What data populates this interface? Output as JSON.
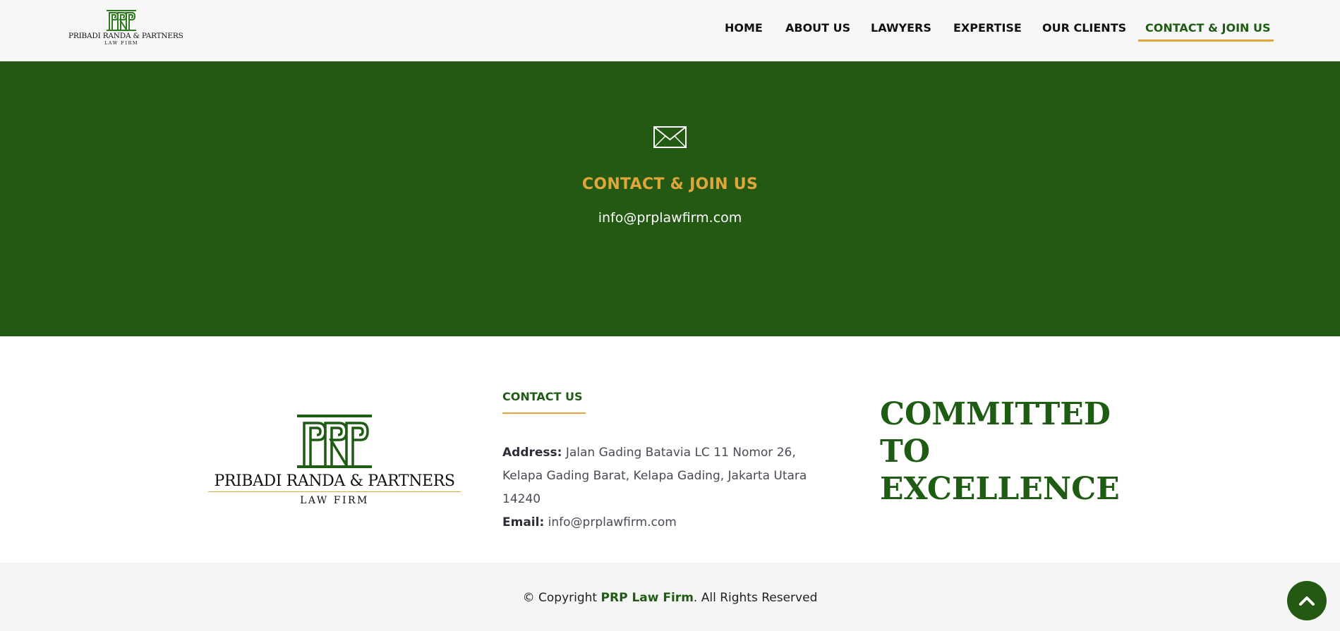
{
  "header": {
    "logo": {
      "monogram": "PRP",
      "firm_name": "PRIBADI RANDA & PARTNERS",
      "firm_sub": "LAW FIRM"
    },
    "nav": [
      {
        "label": "HOME"
      },
      {
        "label": "ABOUT US"
      },
      {
        "label": "LAWYERS"
      },
      {
        "label": "EXPERTISE"
      },
      {
        "label": "OUR CLIENTS"
      },
      {
        "label": "CONTACT & JOIN US",
        "active": true
      }
    ]
  },
  "hero": {
    "icon": "mail-icon",
    "title": "CONTACT & JOIN US",
    "email": "info@prplawfirm.com"
  },
  "footer": {
    "logo": {
      "monogram": "PRP",
      "firm_name": "PRIBADI RANDA & PARTNERS",
      "firm_sub": "LAW FIRM"
    },
    "contact": {
      "heading": "CONTACT US",
      "address_label": "Address:",
      "address": "Jalan Gading Batavia LC 11 Nomor 26, Kelapa Gading Barat, Kelapa Gading, Jakarta Utara 14240",
      "email_label": "Email:",
      "email": "info@prplawfirm.com"
    },
    "tagline": [
      "COMMITTED",
      "TO",
      "EXCELLENCE"
    ]
  },
  "bottom": {
    "copyright_prefix": "© Copyright",
    "brand": "PRP Law Firm",
    "copyright_suffix": ". All Rights Reserved",
    "scroll_top_icon": "chevron-up-icon"
  },
  "colors": {
    "brand_green": "#245913",
    "accent_gold": "#e0a63a",
    "header_bg": "#f7f7f7"
  }
}
